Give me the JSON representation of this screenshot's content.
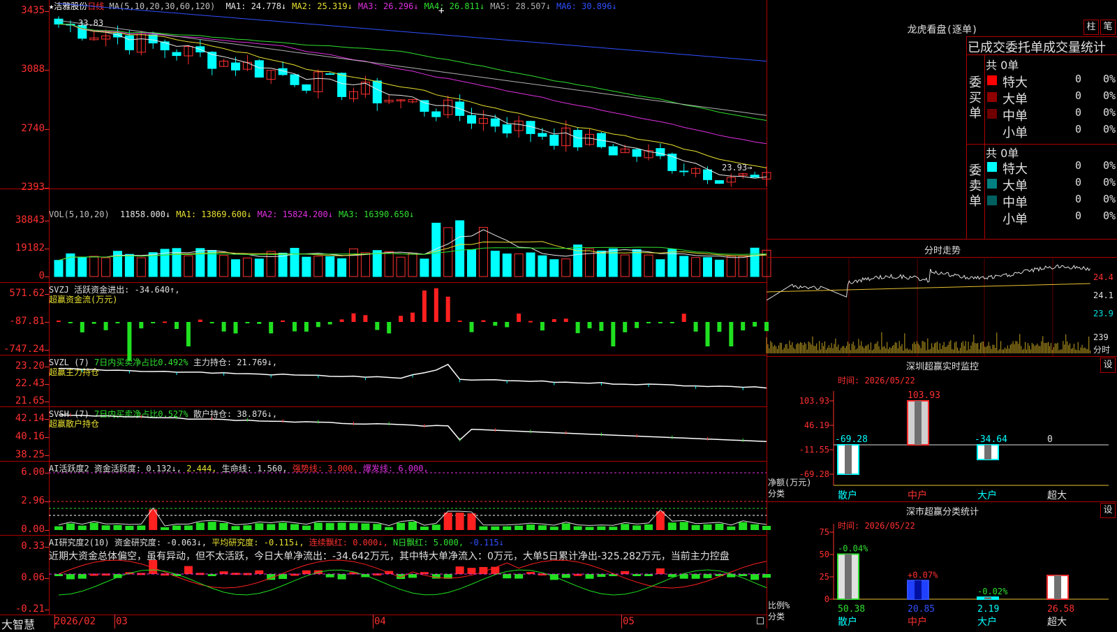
{
  "main": {
    "star": "★",
    "stock_name": "洁雅股份",
    "period": "日线",
    "ma_def": "MA(5,10,20,30,60,120)",
    "ma": [
      {
        "label": "MA1: 24.778↓",
        "color": "#e8e8e8"
      },
      {
        "label": "MA2: 25.319↓",
        "color": "#e8e030"
      },
      {
        "label": "MA3: 26.296↓",
        "color": "#e030e0"
      },
      {
        "label": "MA4: 26.811↓",
        "color": "#30e030"
      },
      {
        "label": "MA5: 28.507↓",
        "color": "#b0b0b0"
      },
      {
        "label": "MA6: 30.896↓",
        "color": "#3050ff"
      }
    ],
    "y_ticks": [
      "3435",
      "3088",
      "2740",
      "2393"
    ],
    "high_label": "33.83",
    "low_label": "23.93→",
    "cursor_plus": "+"
  },
  "vol": {
    "title": "VOL(5,10,20)",
    "values": [
      {
        "label": "11858.000↓",
        "color": "#e8e8e8"
      },
      {
        "label": "MA1: 13869.600↓",
        "color": "#e8e030"
      },
      {
        "label": "MA2: 15824.200↓",
        "color": "#e030e0"
      },
      {
        "label": "MA3: 16390.650↓",
        "color": "#30e030"
      }
    ],
    "y_ticks": [
      "38843",
      "19182",
      "0"
    ]
  },
  "svzj": {
    "title": "SVZJ  活跃资金进出: -34.640↑,",
    "subtitle": "超赢资金流(万元)",
    "y_ticks": [
      "571.62",
      "-87.81",
      "-747.24"
    ]
  },
  "svzl": {
    "title": "SVZL (7)",
    "text1": "7日内买卖净占比0.492%",
    "text2": "主力持仓: 21.769↓,",
    "subtitle": "超赢主力持仓",
    "y_ticks": [
      "23.20",
      "22.43",
      "21.65"
    ]
  },
  "svsh": {
    "title": "SVSH (7)",
    "text1": "7日内买卖净占比0.527%",
    "text2": "散户持仓: 38.876↓,",
    "subtitle": "超赢散户持仓",
    "y_ticks": [
      "42.14",
      "40.16",
      "38.25"
    ]
  },
  "ai1": {
    "title": "AI活跃度2",
    "t1": "资金活跃度: 0.132↓,",
    "t2": "2.444,",
    "t3": "生命线: 1.560,",
    "t4": "强势线: 3.000,",
    "t5": "爆发线: 6.000,",
    "y_ticks": [
      "6.00",
      "2.96",
      "0.00"
    ]
  },
  "ai2": {
    "title": "AI研究度2(10)",
    "t1": "资金研究度: -0.063↓,",
    "t2": "平均研究度: -0.115↓,",
    "t3": "连续飘红: 0.000↓,",
    "t4": "N日飘红: 5.000,",
    "t5": "-0.115↓",
    "comment": "近期大资金总体偏空，虽有异动，但不太活跃，今日大单净流出：-34.642万元，其中特大单净流入：0万元，大单5日累计净出-325.282万元，当前主力控盘",
    "y_ticks": [
      "0.33",
      "0.06",
      "-0.21"
    ]
  },
  "xaxis": {
    "brand": "大智慧",
    "labels": [
      "2026/02",
      "03",
      "04",
      "05"
    ]
  },
  "right": {
    "dragon_title": "龙虎看盘(逐单)",
    "btn_bar": "柱",
    "btn_pen": "笔",
    "order_title": "已成交委托单成交量统计",
    "buy_label": "委买单",
    "sell_label": "委卖单",
    "buy_total": "共 0单",
    "sell_total": "共 0单",
    "buy_rows": [
      {
        "name": "特大",
        "color": "#ff0000",
        "count": "0",
        "pct": "0%"
      },
      {
        "name": "大单",
        "color": "#900000",
        "count": "0",
        "pct": "0%"
      },
      {
        "name": "中单",
        "color": "#700000",
        "count": "0",
        "pct": "0%"
      },
      {
        "name": "小单",
        "color": "#000000",
        "count": "0",
        "pct": "0%"
      }
    ],
    "sell_rows": [
      {
        "name": "特大",
        "color": "#00ffff",
        "count": "0",
        "pct": "0%"
      },
      {
        "name": "大单",
        "color": "#008080",
        "count": "0",
        "pct": "0%"
      },
      {
        "name": "中单",
        "color": "#006060",
        "count": "0",
        "pct": "0%"
      },
      {
        "name": "小单",
        "color": "#000000",
        "count": "0",
        "pct": "0%"
      }
    ],
    "intraday_title": "分时走势",
    "intraday_y": [
      "24.4",
      "24.1",
      "23.9"
    ],
    "intraday_vol": "239",
    "intraday_unit": "分时",
    "sz_monitor_title": "深圳超赢实时监控",
    "sz_set": "设",
    "sz_time": "时间: 2026/05/22",
    "sz_y": [
      "103.93",
      "46.19",
      "-11.55",
      "-69.28"
    ],
    "sz_bars": [
      {
        "cat": "散户",
        "value": -69.28,
        "label": "-69.28"
      },
      {
        "cat": "中户",
        "value": 103.93,
        "label": "103.93"
      },
      {
        "cat": "大户",
        "value": -34.64,
        "label": "-34.64"
      },
      {
        "cat": "超大",
        "value": 0,
        "label": "0"
      }
    ],
    "sz_net_label": "净额(万元)",
    "sz_cat_label": "分类",
    "sm_title": "深市超赢分类统计",
    "sm_set": "设",
    "sm_time": "时间: 2026/05/22",
    "sm_y": [
      "75",
      "50",
      "25",
      "0"
    ],
    "sm_bars": [
      {
        "cat": "散户",
        "value": 50.38,
        "label": "50.38",
        "chg": "-0.04%"
      },
      {
        "cat": "中户",
        "value": 20.85,
        "label": "20.85",
        "chg": "+0.07%"
      },
      {
        "cat": "大户",
        "value": 2.19,
        "label": "2.19",
        "chg": "-0.02%"
      },
      {
        "cat": "超大",
        "value": 26.58,
        "label": "26.58",
        "chg": ""
      }
    ],
    "sm_ratio_label": "比例%",
    "sm_cat_label": "分类"
  }
}
